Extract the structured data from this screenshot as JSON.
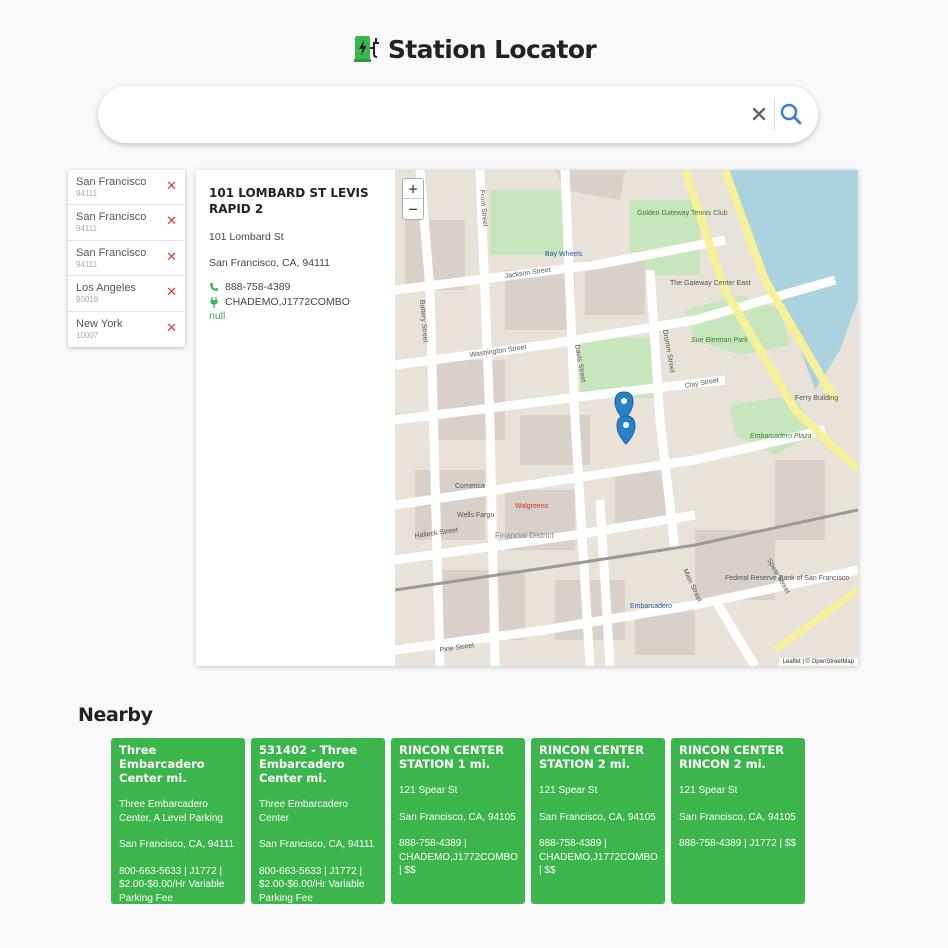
{
  "app": {
    "title": "Station Locator"
  },
  "search": {
    "value": "",
    "placeholder": ""
  },
  "recent": [
    {
      "city": "San Francisco",
      "zip": "94111"
    },
    {
      "city": "San Francisco",
      "zip": "94111"
    },
    {
      "city": "San Francisco",
      "zip": "94111"
    },
    {
      "city": "Los Angeles",
      "zip": "90018"
    },
    {
      "city": "New York",
      "zip": "10007"
    }
  ],
  "selected": {
    "name": "101 LOMBARD ST LEVIS RAPID 2",
    "street": "101 Lombard St",
    "city_line": "San Francisco, CA, 94111",
    "phone": "888-758-4389",
    "connectors": "CHADEMO,J1772COMBO",
    "pricing": "null"
  },
  "map": {
    "zoom_in": "+",
    "zoom_out": "−",
    "attribution": "Leaflet | © OpenStreetMap",
    "labels": {
      "bay_wheels": "Bay Wheels",
      "gateway_center": "The Gateway Center East",
      "washington_street": "Washington Street",
      "jackson_street": "Jackson Street",
      "sue_bierman_park": "Sue Bierman Park",
      "embarcadero_plaza": "Embarcadero Plaza",
      "ferry_building": "Ferry Building",
      "financial_district": "Financial District",
      "embarcadero": "Embarcadero",
      "drumm_street": "Drumm Street",
      "davis_street": "Davis Street",
      "front_street": "Front Street",
      "battery_street": "Battery Street",
      "clay_street": "Clay Street",
      "pine_street": "Pine Street",
      "halleck_street": "Halleck Street",
      "spear_street": "Spear Street",
      "main_street": "Main Street",
      "golden_gateway_tennis": "Golden Gateway Tennis Club",
      "walgreens": "Walgreens",
      "wells_fargo": "Wells Fargo",
      "comerica": "Comerica",
      "federal_reserve": "Federal Reserve Bank of San Francisco"
    }
  },
  "nearby": {
    "title": "Nearby",
    "cards": [
      {
        "title": "Three Embarcadero Center mi.",
        "address": "Three Embarcadero Center, A Level Parking",
        "city": "San Francisco, CA, 94111",
        "details": "800-663-5633 | J1772 | $2.00-$6.00/Hr Variable Parking Fee"
      },
      {
        "title": "531402 - Three Embarcadero Center mi.",
        "address": "Three Embarcadero Center",
        "city": "San Francisco, CA, 94111",
        "details": "800-663-5633 | J1772 | $2.00-$6.00/Hr Variable Parking Fee"
      },
      {
        "title": "RINCON CENTER STATION 1 mi.",
        "address": "121 Spear St",
        "city": "San Francisco, CA, 94105",
        "details": "888-758-4389 | CHADEMO,J1772COMBO | $$"
      },
      {
        "title": "RINCON CENTER STATION 2 mi.",
        "address": "121 Spear St",
        "city": "San Francisco, CA, 94105",
        "details": "888-758-4389 | CHADEMO,J1772COMBO | $$"
      },
      {
        "title": "RINCON CENTER RINCON 2 mi.",
        "address": "121 Spear St",
        "city": "San Francisco, CA, 94105",
        "details": "888-758-4389 | J1772 | $$"
      }
    ]
  },
  "colors": {
    "accent": "#3cb54c",
    "search_icon": "#3b7dd8",
    "remove_icon": "#e53935",
    "marker": "#2a81cb"
  },
  "icons": [
    "ev-station-logo-icon",
    "clear-icon",
    "search-icon",
    "remove-icon",
    "phone-icon",
    "plug-icon",
    "map-marker-icon"
  ]
}
